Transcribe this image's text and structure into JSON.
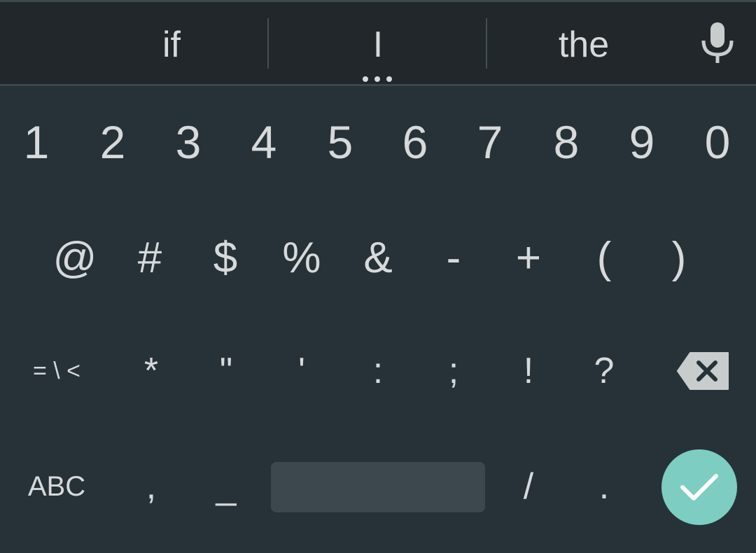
{
  "suggestions": {
    "left": "if",
    "center": "I",
    "right": "the",
    "mic_icon": "microphone-icon",
    "more_icon": "more-dots-icon"
  },
  "rows": {
    "numbers": [
      "1",
      "2",
      "3",
      "4",
      "5",
      "6",
      "7",
      "8",
      "9",
      "0"
    ],
    "symbols": [
      "@",
      "#",
      "$",
      "%",
      "&",
      "-",
      "+",
      "(",
      ")"
    ],
    "punctuation": {
      "more_symbols": "= \\ <",
      "keys": [
        "*",
        "\"",
        "'",
        ":",
        ";",
        "!",
        "?"
      ],
      "backspace_icon": "backspace-icon"
    },
    "bottom": {
      "abc": "ABC",
      "comma": ",",
      "underscore": "_",
      "slash": "/",
      "period": ".",
      "enter_icon": "checkmark-icon"
    }
  },
  "colors": {
    "background": "#263238",
    "suggestion_bar": "#21272b",
    "key_text": "#d7d9da",
    "space_bar": "#3d484e",
    "enter": "#7dcdc2"
  }
}
